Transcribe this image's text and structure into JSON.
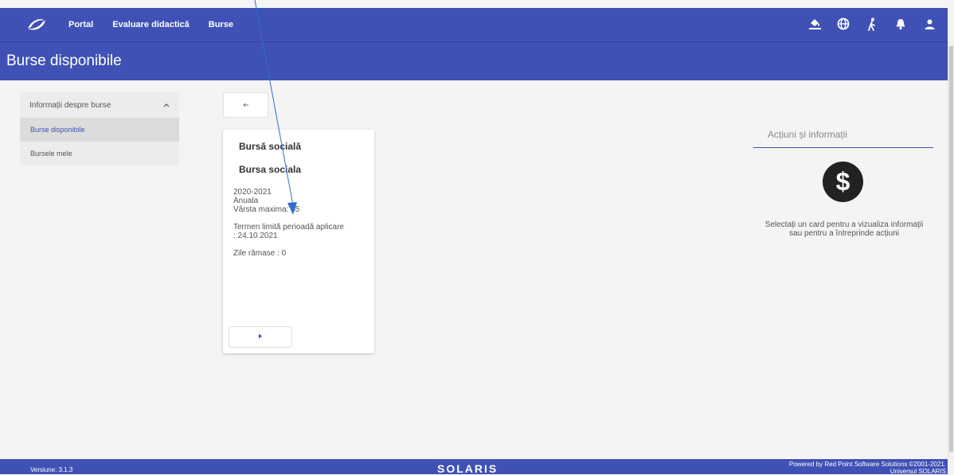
{
  "nav": {
    "links": [
      "Portal",
      "Evaluare didactică",
      "Burse"
    ],
    "icons": [
      "accessibility-paint-icon",
      "globe-icon",
      "walk-icon",
      "bell-icon",
      "person-icon"
    ]
  },
  "page": {
    "title": "Burse disponibile"
  },
  "sidebar": {
    "section": "Informații despre burse",
    "items": [
      {
        "label": "Burse disponibile",
        "active": true
      },
      {
        "label": "Bursele mele",
        "active": false
      }
    ]
  },
  "card": {
    "title": "Bursă socială",
    "subtitle": "Bursa sociala",
    "year": "2020-2021",
    "period": "Anuala",
    "age": "Vârsta maxima: 35",
    "deadline_label": "Termen limită perioadă aplicare",
    "deadline_value": ": 24.10.2021",
    "days_left": "Zile rămase : 0"
  },
  "right_panel": {
    "title": "Acțiuni și informații",
    "icon": "dollar-icon",
    "message": "Selectați un card pentru a vizualiza informații sau pentru a întreprinde acțiuni"
  },
  "footer": {
    "version": "Versiune: 3.1.3",
    "brand": "SOLARIS",
    "powered": "Powered by Red Point Software Solutions ©2001-2021.",
    "powered2": "Universul SOLARIS"
  },
  "colors": {
    "primary": "#3f51b5",
    "background": "#f4f4f4"
  }
}
